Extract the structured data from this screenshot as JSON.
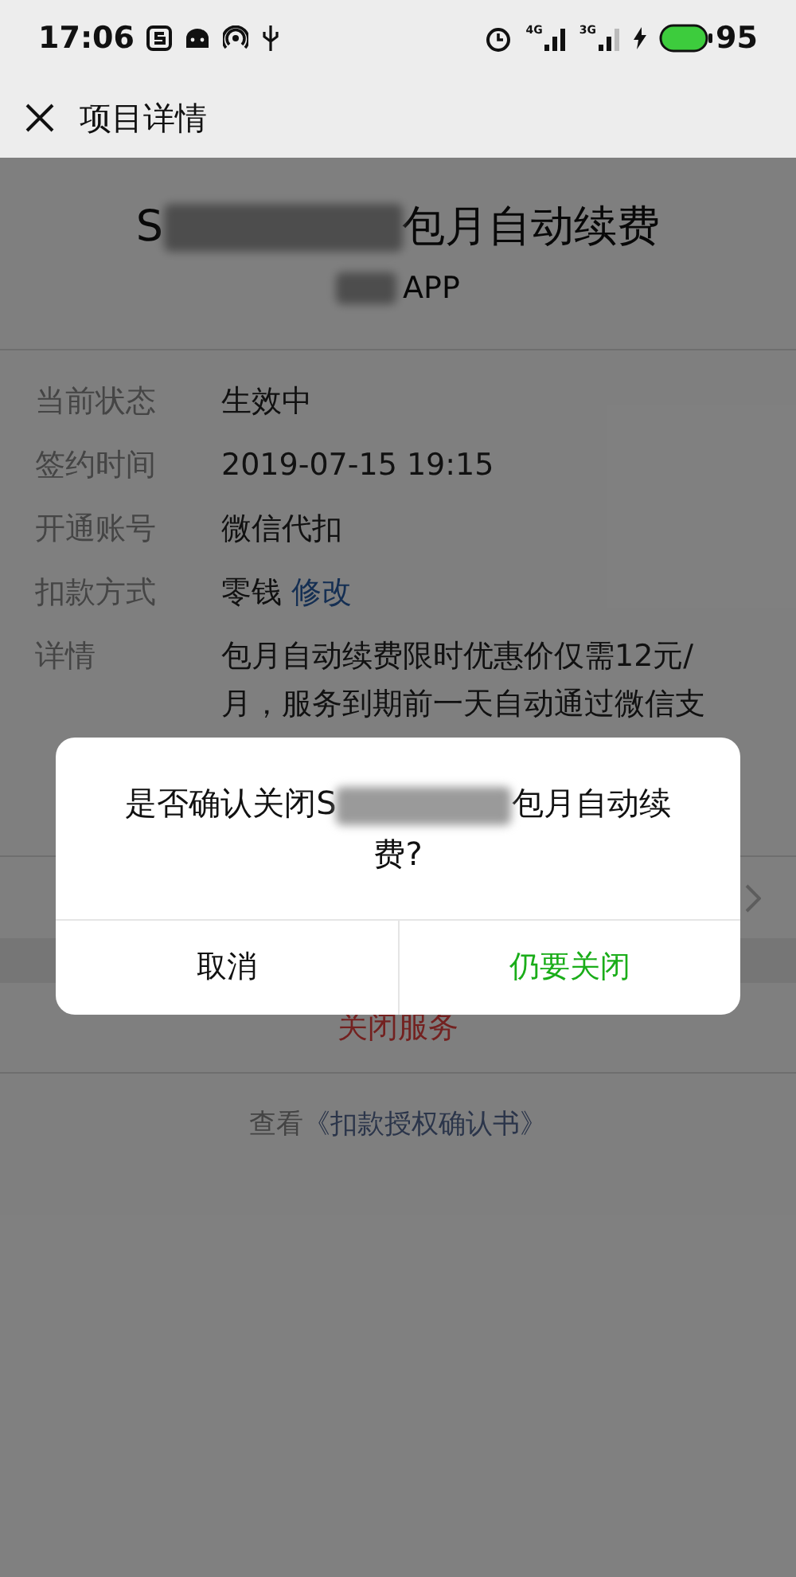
{
  "status_bar": {
    "time": "17:06",
    "signals": [
      {
        "label": "4G"
      },
      {
        "label": "3G"
      }
    ],
    "battery": "95"
  },
  "header": {
    "title": "项目详情"
  },
  "service": {
    "title_start": "S",
    "title_end": "包月自动续费",
    "subtitle": "APP"
  },
  "fields": [
    {
      "label": "当前状态",
      "value": "生效中"
    },
    {
      "label": "签约时间",
      "value": "2019-07-15 19:15"
    },
    {
      "label": "开通账号",
      "value": "微信代扣"
    },
    {
      "label": "扣款方式",
      "value": "零钱",
      "link": "修改"
    },
    {
      "label": "详情",
      "value": "包月自动续费限时优惠价仅需12元/月，服务到期前一天自动通过微信支"
    }
  ],
  "close_button": "关闭服务",
  "footer": {
    "prefix": "查看",
    "link": "《扣款授权确认书》"
  },
  "dialog": {
    "message_start": "是否确认关闭S",
    "message_end": "包月自动续费?",
    "buttons": [
      {
        "label": "取消",
        "kind": "cancel"
      },
      {
        "label": "仍要关闭",
        "kind": "confirm"
      }
    ]
  }
}
